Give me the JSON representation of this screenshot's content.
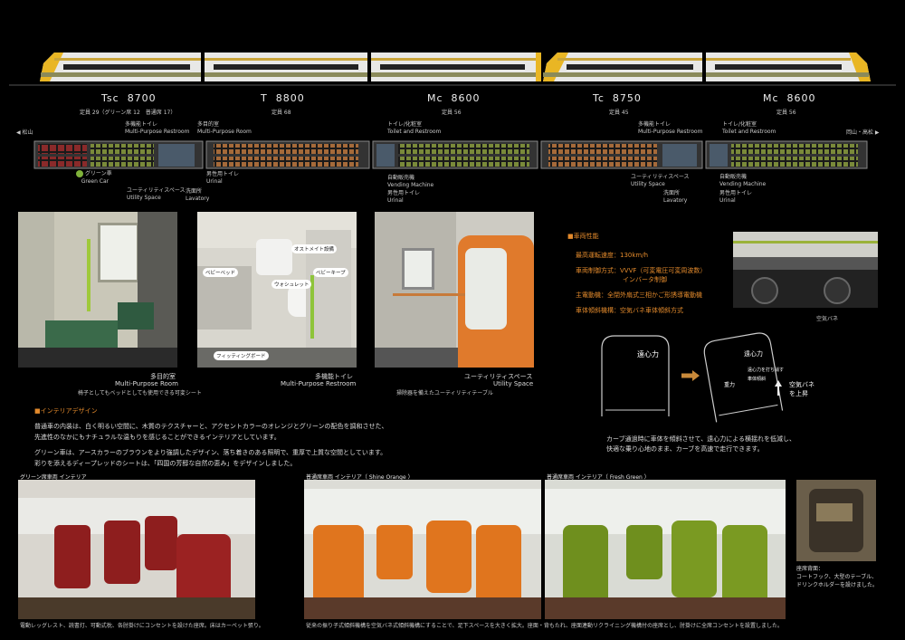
{
  "train": {
    "cars": [
      {
        "type": "Tsc",
        "num": "8700",
        "cap": "定員 29（グリーン席 12　普通席 17）"
      },
      {
        "type": "T",
        "num": "8800",
        "cap": "定員 68"
      },
      {
        "type": "Mc",
        "num": "8600",
        "cap": "定員 56"
      },
      {
        "type": "Tc",
        "num": "8750",
        "cap": "定員 45"
      },
      {
        "type": "Mc",
        "num": "8600",
        "cap": "定員 56"
      }
    ],
    "left_dest": "松山",
    "right_dest": "岡山・高松",
    "legend_green": "グリーン車",
    "legend_green_en": "Green Car"
  },
  "plan_labels": {
    "toilet1": "多機能トイレ",
    "toilet1_en": "Multi-Purpose Restroom",
    "room1": "多目的室",
    "room1_en": "Multi-Purpose Room",
    "wc2": "トイレ/化粧室",
    "wc2_en": "Toilet and Restroom",
    "urinal": "男性用トイレ",
    "urinal_en": "Urinal",
    "util": "ユーティリティスペース",
    "util_en": "Utility Space",
    "lav": "洗面所",
    "lav_en": "Lavatory",
    "vend": "自動販売機",
    "vend_en": "Vending Machine"
  },
  "photos": {
    "p1_title": "多目的室",
    "p1_en": "Multi-Purpose Room",
    "p1_note": "椅子としてもベッドとしても使用できる可変シート",
    "p2_title": "多機能トイレ",
    "p2_en": "Multi-Purpose Restroom",
    "p2_l1": "オストメイト設備",
    "p2_l2": "ベビーベッド",
    "p2_l3": "ベビーキープ",
    "p2_l4": "ウォシュレット",
    "p2_l5": "フィッティングボード",
    "p3_title": "ユーティリティスペース",
    "p3_en": "Utility Space",
    "p3_note": "掃除器を備えたユーティリティテーブル"
  },
  "specs": {
    "heading": "■車両性能",
    "l1": "最高運転速度：130km/h",
    "l2": "車両制御方式：VVVF（可変電圧可変周波数）",
    "l2b": "インバータ制御",
    "l3": "主電動機：全閉外扇式三相かご形誘導電動機",
    "l4": "車体傾斜機構：空気バネ車体傾斜方式",
    "air": "空気バネ",
    "cf1": "遠心力",
    "cf2": "遠心力",
    "cf_small": "遠心力を打ち消す",
    "tilt_small": "車体傾斜",
    "gravity": "重力",
    "air_up": "空気バネ",
    "air_up2": "を上昇",
    "note1": "カーブ通過時に車体を傾斜させて、遠心力による横揺れを低減し、",
    "note2": "快適な乗り心地のまま、カーブを高速で走行できます。"
  },
  "interior": {
    "heading": "■インテリアデザイン",
    "p1": "普通車の内装は、白く明るい空間に、木質のテクスチャーと、アクセントカラーのオレンジとグリーンの配色を調和させた、",
    "p2": "先進性のなかにもナチュラルな温もりを感じることができるインテリアとしています。",
    "p3": "グリーン車は、アースカラーのブラウンをより強調したデザイン、落ち着きのある照明で、重厚で上質な空間としています。",
    "p4": "彩りを添えるディープレッドのシートは、「四国の芳醇な自然の恵み」をデザインしました。"
  },
  "bottom": {
    "g_title": "グリーン席車両 インテリア",
    "o_title": "普通席車両 インテリア（ Shine Orange ）",
    "f_title": "普通席車両 インテリア（ Fresh Green ）",
    "g_cap": "電動レッグレスト、読書灯、可動式枕、各肘掛けにコンセントを設けた座席。床はカーペット張り。",
    "of_cap": "従来の振り子式傾斜機構を空気バネ式傾斜機構にすることで、足下スペースを大きく拡大。座面・背もたれ、座面連動リクライニング機構付の座席とし、肘掛けに全席コンセントを設置しました。",
    "s_head": "座席背面：",
    "s_l1": "コートフック、大型のテーブル、",
    "s_l2": "ドリンクホルダーを設けました。"
  }
}
